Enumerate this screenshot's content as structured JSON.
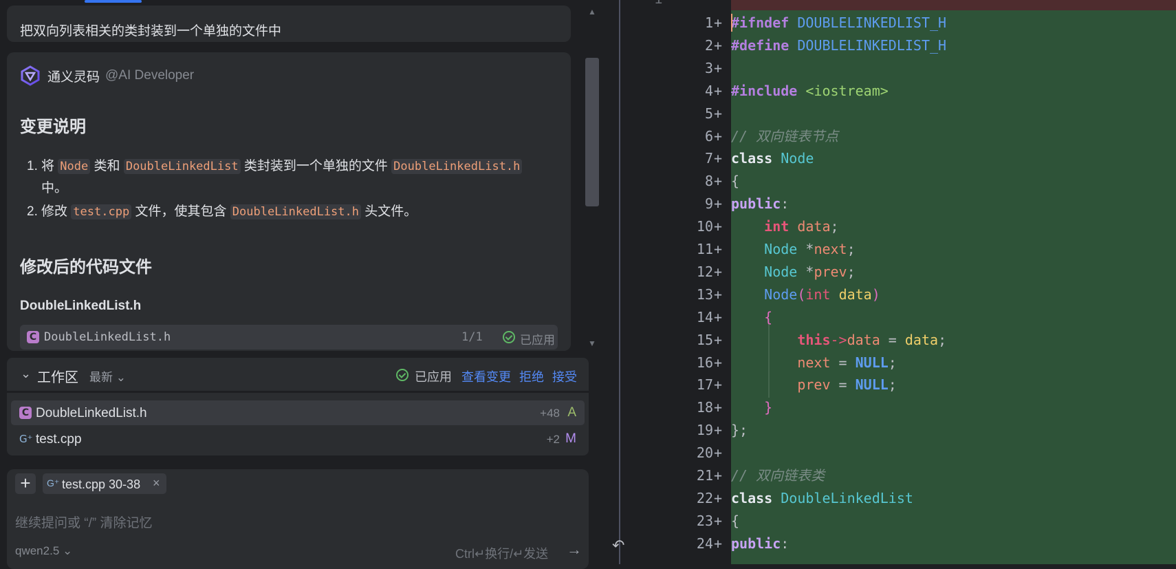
{
  "chat": {
    "user_message": "把双向列表相关的类封装到一个单独的文件中",
    "agent_name": "通义灵码",
    "agent_handle": "@AI Developer",
    "section1_title": "变更说明",
    "changes": [
      {
        "num": "1.",
        "pre": "将",
        "code1": "Node",
        "mid1": "类和",
        "code2": "DoubleLinkedList",
        "mid2": "类封装到一个单独的文件",
        "code3": "DoubleLinkedList.h",
        "post": "中。"
      },
      {
        "num": "2.",
        "pre": "修改",
        "code1": "test.cpp",
        "mid1": "文件，使其包含",
        "code2": "DoubleLinkedList.h",
        "post": "头文件。"
      }
    ],
    "section2_title": "修改后的代码文件",
    "file_heading": "DoubleLinkedList.h",
    "file_chip": {
      "name": "DoubleLinkedList.h",
      "count": "1/1",
      "status": "已应用"
    }
  },
  "workspace": {
    "title": "工作区",
    "filter": "最新",
    "applied": "已应用",
    "links": {
      "view": "查看变更",
      "reject": "拒绝",
      "accept": "接受"
    },
    "files": [
      {
        "name": "DoubleLinkedList.h",
        "added": "+48",
        "status": "A"
      },
      {
        "name": "test.cpp",
        "added": "+2",
        "status": "M"
      }
    ]
  },
  "composer": {
    "context_chip": "test.cpp 30-38",
    "placeholder": "继续提问或 “/” 清除记忆",
    "model": "qwen2.5",
    "send_hint": "Ctrl↵换行/↵发送"
  },
  "editor": {
    "old_line_number": "1",
    "lines": [
      {
        "n": "1",
        "html": "<span style='color:#b47fe0;font-weight:bold'>#ifndef</span> <span style='color:#5e9cf0'>DOUBLELINKEDLIST_H</span>"
      },
      {
        "n": "2",
        "html": "<span style='color:#b47fe0;font-weight:bold'>#define</span> <span style='color:#5e9cf0'>DOUBLELINKEDLIST_H</span>"
      },
      {
        "n": "3",
        "html": ""
      },
      {
        "n": "4",
        "html": "<span style='color:#b47fe0;font-weight:bold'>#include</span> <span style='color:#9ed473'>&lt;iostream&gt;</span>"
      },
      {
        "n": "5",
        "html": ""
      },
      {
        "n": "6",
        "html": "<span style='color:#7a8c86;font-style:italic'>// 双向链表节点</span>"
      },
      {
        "n": "7",
        "html": "<span style='color:#e6e9f0;font-weight:bold'>class</span> <span style='color:#57c7d2'>Node</span>"
      },
      {
        "n": "8",
        "html": "{"
      },
      {
        "n": "9",
        "html": "<span style='color:#c8a3f5;font-weight:bold'>public</span>:"
      },
      {
        "n": "10",
        "html": "    <span style='color:#e6567a;font-weight:bold'>int</span> <span style='color:#ee8a74'>data</span>;"
      },
      {
        "n": "11",
        "html": "    <span style='color:#57c7d2'>Node</span> *<span style='color:#ee8a74'>next</span>;"
      },
      {
        "n": "12",
        "html": "    <span style='color:#57c7d2'>Node</span> *<span style='color:#ee8a74'>prev</span>;"
      },
      {
        "n": "13",
        "html": "    <span style='color:#5e9cf0'>Node</span><span style='color:#e06cc0'>(</span><span style='color:#e6567a'>int</span> <span style='color:#f0cf6a'>data</span><span style='color:#e06cc0'>)</span>"
      },
      {
        "n": "14",
        "html": "    <span style='color:#e06cc0'>{</span>"
      },
      {
        "n": "15",
        "html": "        <span style='color:#e6567a;font-weight:bold'>this</span><span style='color:#e6567a'>-&gt;</span><span style='color:#ee8a74'>data</span> = <span style='color:#f0cf6a'>data</span>;"
      },
      {
        "n": "16",
        "html": "        <span style='color:#ee8a74'>next</span> = <span style='color:#5e9cf0;font-weight:bold'>NULL</span>;"
      },
      {
        "n": "17",
        "html": "        <span style='color:#ee8a74'>prev</span> = <span style='color:#5e9cf0;font-weight:bold'>NULL</span>;"
      },
      {
        "n": "18",
        "html": "    <span style='color:#e06cc0'>}</span>"
      },
      {
        "n": "19",
        "html": "};"
      },
      {
        "n": "20",
        "html": ""
      },
      {
        "n": "21",
        "html": "<span style='color:#7a8c86;font-style:italic'>// 双向链表类</span>"
      },
      {
        "n": "22",
        "html": "<span style='color:#e6e9f0;font-weight:bold'>class</span> <span style='color:#57c7d2'>DoubleLinkedList</span>"
      },
      {
        "n": "23",
        "html": "{"
      },
      {
        "n": "24",
        "html": "<span style='color:#c8a3f5;font-weight:bold'>public</span>:"
      }
    ]
  }
}
